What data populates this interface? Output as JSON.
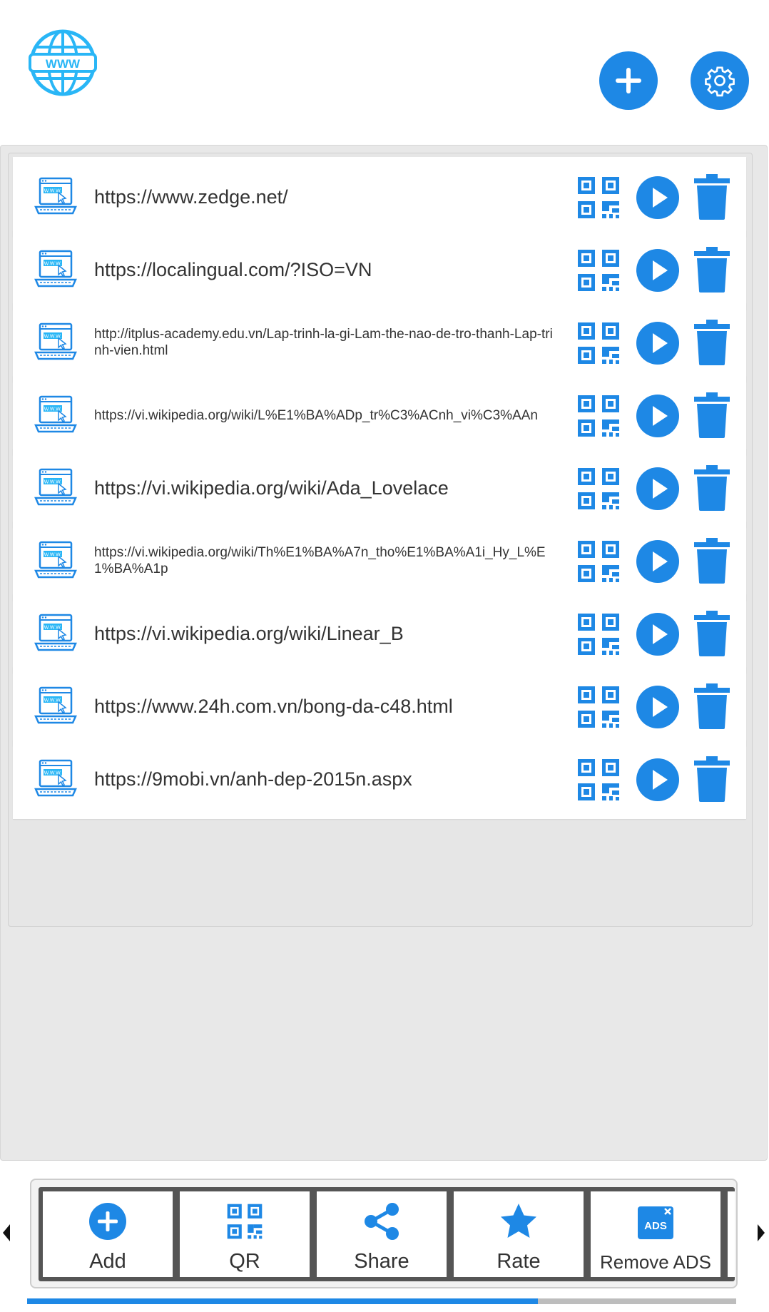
{
  "header": {
    "logo_text": "WWW",
    "add_icon": "plus-icon",
    "settings_icon": "gear-icon"
  },
  "colors": {
    "accent": "#1e88e5",
    "logo": "#29b6f6"
  },
  "urls": [
    {
      "text": "https://www.zedge.net/",
      "small": false
    },
    {
      "text": "https://localingual.com/?ISO=VN",
      "small": false
    },
    {
      "text": "http://itplus-academy.edu.vn/Lap-trinh-la-gi-Lam-the-nao-de-tro-thanh-Lap-trinh-vien.html",
      "small": true
    },
    {
      "text": "https://vi.wikipedia.org/wiki/L%E1%BA%ADp_tr%C3%ACnh_vi%C3%AAn",
      "small": true
    },
    {
      "text": "https://vi.wikipedia.org/wiki/Ada_Lovelace",
      "small": false
    },
    {
      "text": "https://vi.wikipedia.org/wiki/Th%E1%BA%A7n_tho%E1%BA%A1i_Hy_L%E1%BA%A1p",
      "small": true
    },
    {
      "text": "https://vi.wikipedia.org/wiki/Linear_B",
      "small": false
    },
    {
      "text": "https://www.24h.com.vn/bong-da-c48.html",
      "small": false
    },
    {
      "text": "https://9mobi.vn/anh-dep-2015n.aspx",
      "small": false
    }
  ],
  "bottom_nav": {
    "add": "Add",
    "qr": "QR",
    "share": "Share",
    "rate": "Rate",
    "remove_ads": "Remove ADS",
    "ads_badge": "ADS"
  },
  "scroll_progress": 0.72
}
